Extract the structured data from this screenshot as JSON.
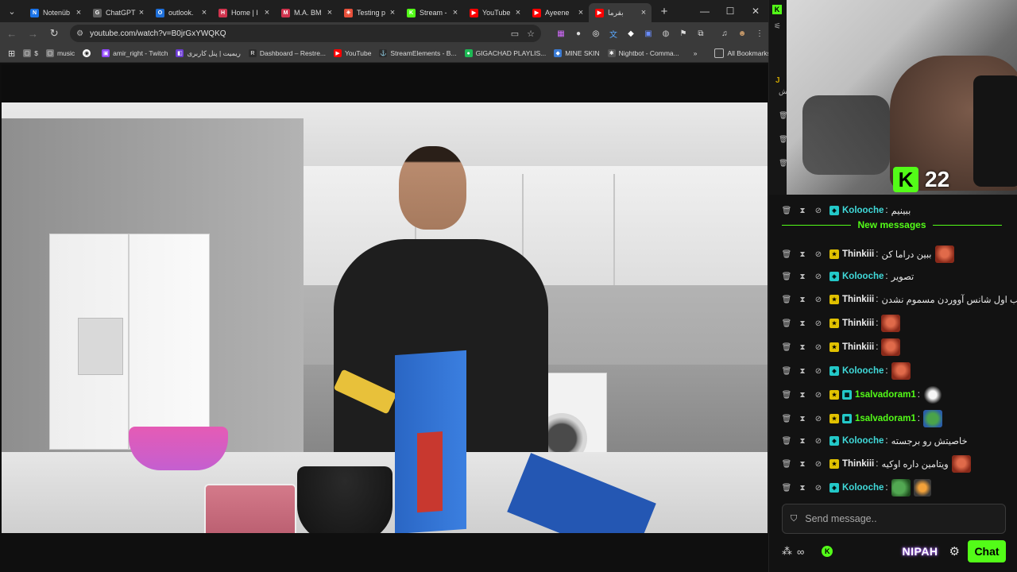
{
  "browser": {
    "tabs": [
      {
        "title": "Notenüb",
        "color": "#1a73e8",
        "glyph": "N"
      },
      {
        "title": "ChatGPT",
        "color": "#5f5f5f",
        "glyph": "G"
      },
      {
        "title": "outlook.",
        "color": "#1e6fd9",
        "glyph": "O"
      },
      {
        "title": "Home | I",
        "color": "#d0344e",
        "glyph": "H"
      },
      {
        "title": "M.A. BM",
        "color": "#d0344e",
        "glyph": "M"
      },
      {
        "title": "Testing p",
        "color": "#e8503a",
        "glyph": "✳"
      },
      {
        "title": "Stream -",
        "color": "#53fc18",
        "glyph": "K"
      },
      {
        "title": "YouTube",
        "color": "#ff0000",
        "glyph": "▶"
      },
      {
        "title": "Ayeene",
        "color": "#ff0000",
        "glyph": "▶"
      },
      {
        "title": "بقرما",
        "color": "#ff0000",
        "glyph": "▶",
        "active": true
      }
    ],
    "window_controls": {
      "minimize": "—",
      "maximize": "☐",
      "close": "✕"
    },
    "url": "youtube.com/watch?v=B0jrGxYWQKQ",
    "bookmarks": [
      {
        "label": "$",
        "color": "#777777",
        "glyph": "▢"
      },
      {
        "label": "music",
        "color": "#777777",
        "glyph": "▢"
      },
      {
        "label": "",
        "color": "#ffffff",
        "glyph": "◉"
      },
      {
        "label": "amir_right - Twitch",
        "color": "#9146ff",
        "glyph": "▣"
      },
      {
        "label": "ریمیت | پنل کاربری",
        "color": "#6a3ad0",
        "glyph": "◧"
      },
      {
        "label": "Dashboard – Restre...",
        "color": "#2b2b2b",
        "glyph": "R"
      },
      {
        "label": "YouTube",
        "color": "#ff0000",
        "glyph": "▶"
      },
      {
        "label": "StreamElements - B...",
        "color": "#2b2b2b",
        "glyph": "⚓"
      },
      {
        "label": "GIGACHAD PLAYLIS...",
        "color": "#1db954",
        "glyph": "●"
      },
      {
        "label": "MINE SKIN",
        "color": "#3a7bd5",
        "glyph": "◆"
      },
      {
        "label": "Nightbot - Comma...",
        "color": "#555555",
        "glyph": "✱"
      }
    ],
    "bookmarks_more": "»",
    "all_bookmarks": "All Bookmarks"
  },
  "stream": {
    "viewer_count": "22",
    "side_letter": "J",
    "side_glyph": "ش"
  },
  "chat": {
    "new_messages_label": "New messages",
    "messages": [
      {
        "user": "Kolooche",
        "color": "#40d9d9",
        "badge": "k",
        "text": "ببینیم",
        "emotes": []
      },
      {
        "user": "Thinkiii",
        "color": "#f0f0f0",
        "badge": "sub",
        "text": "ببین دراما کن",
        "emotes": [
          "red"
        ]
      },
      {
        "user": "Kolooche",
        "color": "#40d9d9",
        "badge": "k",
        "text": "تصویر",
        "emotes": []
      },
      {
        "user": "Thinkiii",
        "color": "#f0f0f0",
        "badge": "sub",
        "text": "شب اول شانس آووردن مسموم نشدن",
        "emotes": [
          "cat"
        ]
      },
      {
        "user": "Thinkiii",
        "color": "#f0f0f0",
        "badge": "sub",
        "text": "",
        "emotes": [
          "red"
        ]
      },
      {
        "user": "Thinkiii",
        "color": "#f0f0f0",
        "badge": "sub",
        "text": "",
        "emotes": [
          "red"
        ]
      },
      {
        "user": "Kolooche",
        "color": "#40d9d9",
        "badge": "k",
        "text": "",
        "emotes": [
          "red"
        ]
      },
      {
        "user": "1salvadoram1",
        "color": "#53fc18",
        "badge": "sub",
        "text": "",
        "emotes": [
          "duck"
        ]
      },
      {
        "user": "1salvadoram1",
        "color": "#53fc18",
        "badge": "sub",
        "text": "",
        "emotes": [
          "pepe"
        ]
      },
      {
        "user": "Kolooche",
        "color": "#40d9d9",
        "badge": "k",
        "text": "خاصیتش رو برجسته",
        "emotes": []
      },
      {
        "user": "Thinkiii",
        "color": "#f0f0f0",
        "badge": "sub",
        "text": "ویتامین داره اوکیه",
        "emotes": [
          "red"
        ]
      },
      {
        "user": "Kolooche",
        "color": "#40d9d9",
        "badge": "k",
        "text": "",
        "emotes": [
          "frog",
          "dance"
        ]
      }
    ],
    "input_placeholder": "Send message..",
    "brand": "NIPAH",
    "chat_button": "Chat",
    "emoji_glyph": "∞"
  }
}
